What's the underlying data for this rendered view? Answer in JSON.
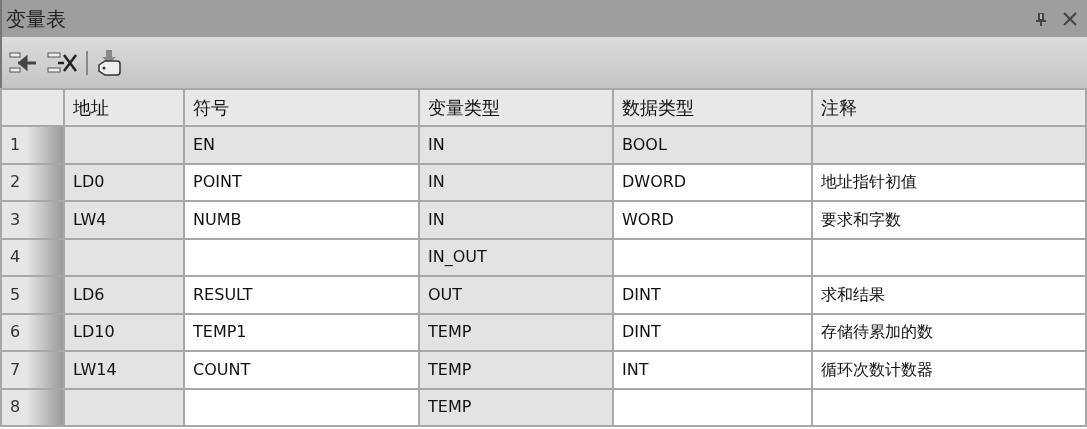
{
  "window": {
    "title": "变量表"
  },
  "columns": [
    {
      "label": "地址",
      "editable": false
    },
    {
      "label": "符号",
      "editable": true
    },
    {
      "label": "变量类型",
      "editable": false
    },
    {
      "label": "数据类型",
      "editable": true
    },
    {
      "label": "注释",
      "editable": true
    }
  ],
  "rows": [
    {
      "cells": [
        "1",
        "",
        "EN",
        "IN",
        "BOOL",
        ""
      ],
      "locked": true
    },
    {
      "cells": [
        "2",
        "LD0",
        "POINT",
        "IN",
        "DWORD",
        "地址指针初值"
      ],
      "locked": false
    },
    {
      "cells": [
        "3",
        "LW4",
        "NUMB",
        "IN",
        "WORD",
        "要求和字数"
      ],
      "locked": false
    },
    {
      "cells": [
        "4",
        "",
        "",
        "IN_OUT",
        "",
        ""
      ],
      "locked": false
    },
    {
      "cells": [
        "5",
        "LD6",
        "RESULT",
        "OUT",
        "DINT",
        "求和结果"
      ],
      "locked": false
    },
    {
      "cells": [
        "6",
        "LD10",
        "TEMP1",
        "TEMP",
        "DINT",
        "存储待累加的数"
      ],
      "locked": false
    },
    {
      "cells": [
        "7",
        "LW14",
        "COUNT",
        "TEMP",
        "INT",
        "循环次数计数器"
      ],
      "locked": false
    },
    {
      "cells": [
        "8",
        "",
        "",
        "TEMP",
        "",
        ""
      ],
      "locked": false
    }
  ]
}
